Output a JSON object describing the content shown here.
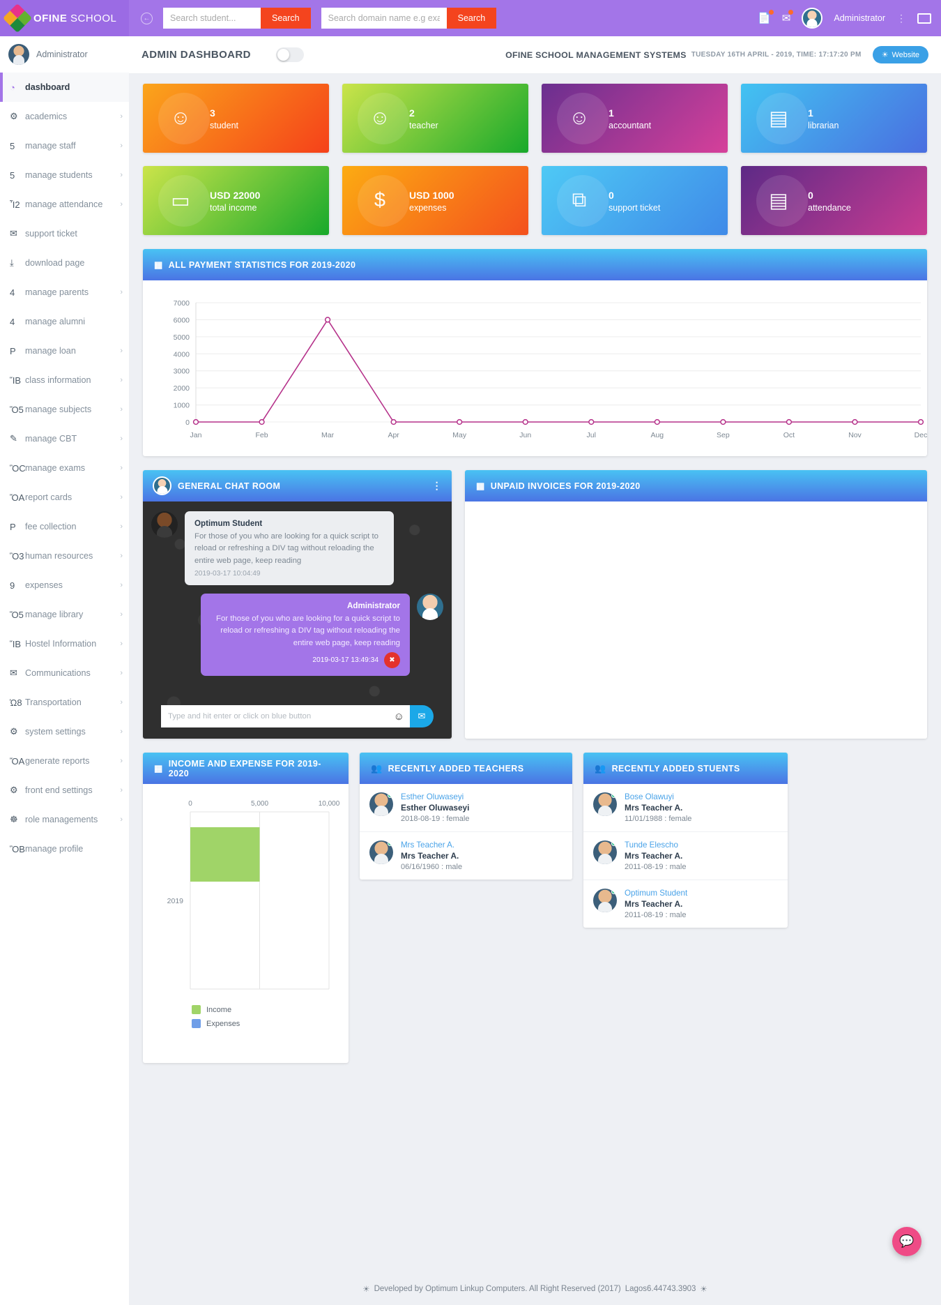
{
  "brand": {
    "bold": "OFINE",
    "light": "SCHOOL"
  },
  "header": {
    "student_search_placeholder": "Search student...",
    "student_search_button": "Search",
    "domain_search_placeholder": "Search domain name e.g exam",
    "domain_search_button": "Search",
    "admin_label": "Administrator",
    "icons": {
      "back": "back-circle-icon",
      "apps": "apps-icon",
      "mail": "mail-icon",
      "kebab": "kebab-menu-icon",
      "window": "window-icon"
    }
  },
  "sidebar": {
    "user": "Administrator",
    "items": [
      {
        "label": "dashboard",
        "icon": "◔",
        "chevron": "",
        "active": true
      },
      {
        "label": "academics",
        "icon": "⚙",
        "chevron": "›",
        "active": false
      },
      {
        "label": "manage staff",
        "icon": "὆5",
        "chevron": "›",
        "active": false
      },
      {
        "label": "manage students",
        "icon": "὆5",
        "chevron": "›",
        "active": false
      },
      {
        "label": "manage attendance",
        "icon": "Ἶ2",
        "chevron": "›",
        "active": false
      },
      {
        "label": "support ticket",
        "icon": "✉",
        "chevron": "",
        "active": false
      },
      {
        "label": "download page",
        "icon": "⤓",
        "chevron": "",
        "active": false
      },
      {
        "label": "manage parents",
        "icon": "὆4",
        "chevron": "›",
        "active": false
      },
      {
        "label": "manage alumni",
        "icon": "὆4",
        "chevron": "",
        "active": false
      },
      {
        "label": "manage loan",
        "icon": "P",
        "chevron": "›",
        "active": false
      },
      {
        "label": "class information",
        "icon": "ἽB",
        "chevron": "›",
        "active": false
      },
      {
        "label": "manage subjects",
        "icon": "Ὅ5",
        "chevron": "›",
        "active": false
      },
      {
        "label": "manage CBT",
        "icon": "✎",
        "chevron": "›",
        "active": false
      },
      {
        "label": "manage exams",
        "icon": "ὋC",
        "chevron": "›",
        "active": false
      },
      {
        "label": "report cards",
        "icon": "ὌA",
        "chevron": "›",
        "active": false
      },
      {
        "label": "fee collection",
        "icon": "P",
        "chevron": "›",
        "active": false
      },
      {
        "label": "human resources",
        "icon": "Ὃ3",
        "chevron": "›",
        "active": false
      },
      {
        "label": "expenses",
        "icon": "὚9",
        "chevron": "›",
        "active": false
      },
      {
        "label": "manage library",
        "icon": "Ὅ5",
        "chevron": "›",
        "active": false
      },
      {
        "label": "Hostel Information",
        "icon": "ἽB",
        "chevron": "›",
        "active": false
      },
      {
        "label": "Communications",
        "icon": "✉",
        "chevron": "›",
        "active": false
      },
      {
        "label": "Transportation",
        "icon": "Ὡ8",
        "chevron": "›",
        "active": false
      },
      {
        "label": "system settings",
        "icon": "⚙",
        "chevron": "›",
        "active": false
      },
      {
        "label": "generate reports",
        "icon": "ὌA",
        "chevron": "›",
        "active": false
      },
      {
        "label": "front end settings",
        "icon": "⚙",
        "chevron": "›",
        "active": false
      },
      {
        "label": "role managements",
        "icon": "☸",
        "chevron": "›",
        "active": false
      },
      {
        "label": "manage profile",
        "icon": "ὋB",
        "chevron": "",
        "active": false
      }
    ]
  },
  "subbar": {
    "page_title": "ADMIN DASHBOARD",
    "system_name": "OFINE SCHOOL MANAGEMENT SYSTEMS",
    "datetime": "TUESDAY 16TH APRIL - 2019, TIME: 17:17:20 PM",
    "website_button": "Website"
  },
  "stat_cards": [
    {
      "value": "3",
      "label": "student",
      "icon": "user-icon",
      "theme": "c-orange"
    },
    {
      "value": "2",
      "label": "teacher",
      "icon": "user-icon",
      "theme": "c-green"
    },
    {
      "value": "1",
      "label": "accountant",
      "icon": "user-icon",
      "theme": "c-purple"
    },
    {
      "value": "1",
      "label": "librarian",
      "icon": "card-icon",
      "theme": "c-blue"
    },
    {
      "value": "USD 22000",
      "label": "total income",
      "icon": "wallet-icon",
      "theme": "c-green2"
    },
    {
      "value": "USD 1000",
      "label": "expenses",
      "icon": "dollar-icon",
      "theme": "c-orange2"
    },
    {
      "value": "0",
      "label": "support ticket",
      "icon": "copy-icon",
      "theme": "c-lblue"
    },
    {
      "value": "0",
      "label": "attendance",
      "icon": "card-icon",
      "theme": "c-purple2"
    }
  ],
  "payment_panel": {
    "title": "ALL PAYMENT STATISTICS FOR 2019-2020",
    "icon": "table-icon"
  },
  "chat": {
    "title": "GENERAL CHAT ROOM",
    "input_placeholder": "Type and hit enter or click on blue button",
    "messages": [
      {
        "author": "Optimum Student",
        "text": "For those of you who are looking for a quick script to reload or refreshing a DIV tag without reloading the entire web page, keep reading",
        "time": "2019-03-17 10:04:49",
        "mine": false
      },
      {
        "author": "Administrator",
        "text": "For those of you who are looking for a quick script to reload or refreshing a DIV tag without reloading the entire web page, keep reading",
        "time": "2019-03-17 13:49:34",
        "mine": true
      }
    ]
  },
  "invoices_panel": {
    "title": "UNPAID INVOICES FOR 2019-2020",
    "icon": "table-icon"
  },
  "income_panel": {
    "title": "INCOME AND EXPENSE FOR 2019-2020",
    "icon": "table-icon"
  },
  "teachers_panel": {
    "title": "RECENTLY ADDED TEACHERS",
    "icon": "people-icon",
    "people": [
      {
        "link": "Esther Oluwaseyi",
        "name": "Esther Oluwaseyi",
        "meta": "2018-08-19 :  female"
      },
      {
        "link": "Mrs Teacher A.",
        "name": "Mrs Teacher A.",
        "meta": "06/16/1960 :  male"
      }
    ]
  },
  "students_panel": {
    "title": "RECENTLY ADDED STUENTS",
    "icon": "people-icon",
    "people": [
      {
        "link": "Bose Olawuyi",
        "name": "Mrs Teacher A.",
        "meta": "11/01/1988 :  female"
      },
      {
        "link": "Tunde Elescho",
        "name": "Mrs Teacher A.",
        "meta": "2011-08-19 :  male"
      },
      {
        "link": "Optimum Student",
        "name": "Mrs Teacher A.",
        "meta": "2011-08-19 :  male"
      }
    ]
  },
  "footer": {
    "text": "Developed by Optimum Linkup Computers. All Right Reserved (2017)",
    "extra": "Lagos6.44743.3903"
  },
  "chart_data": [
    {
      "type": "line",
      "title": "ALL PAYMENT STATISTICS FOR 2019-2020",
      "categories": [
        "Jan",
        "Feb",
        "Mar",
        "Apr",
        "May",
        "Jun",
        "Jul",
        "Aug",
        "Sep",
        "Oct",
        "Nov",
        "Dec"
      ],
      "values": [
        0,
        0,
        6000,
        0,
        0,
        0,
        0,
        0,
        0,
        0,
        0,
        0
      ],
      "yticks": [
        0,
        1000,
        2000,
        3000,
        4000,
        5000,
        6000,
        7000
      ],
      "ylim": [
        0,
        7000
      ],
      "xlabel": "",
      "ylabel": "",
      "grid": true,
      "legend": "none",
      "line_color": "#b5318a",
      "marker": "circle"
    },
    {
      "type": "bar",
      "orientation": "horizontal",
      "title": "INCOME AND EXPENSE FOR 2019-2020",
      "categories": [
        "2019"
      ],
      "series": [
        {
          "name": "Income",
          "values": [
            5000
          ],
          "color": "#a0d468"
        },
        {
          "name": "Expenses",
          "values": [
            0
          ],
          "color": "#6f9ee8"
        }
      ],
      "xticks": [
        0,
        5000,
        10000
      ],
      "xticklabels": [
        "0",
        "5,000",
        "10,000"
      ],
      "xlim": [
        0,
        10000
      ],
      "grid": true,
      "legend": "bottom-left"
    }
  ]
}
